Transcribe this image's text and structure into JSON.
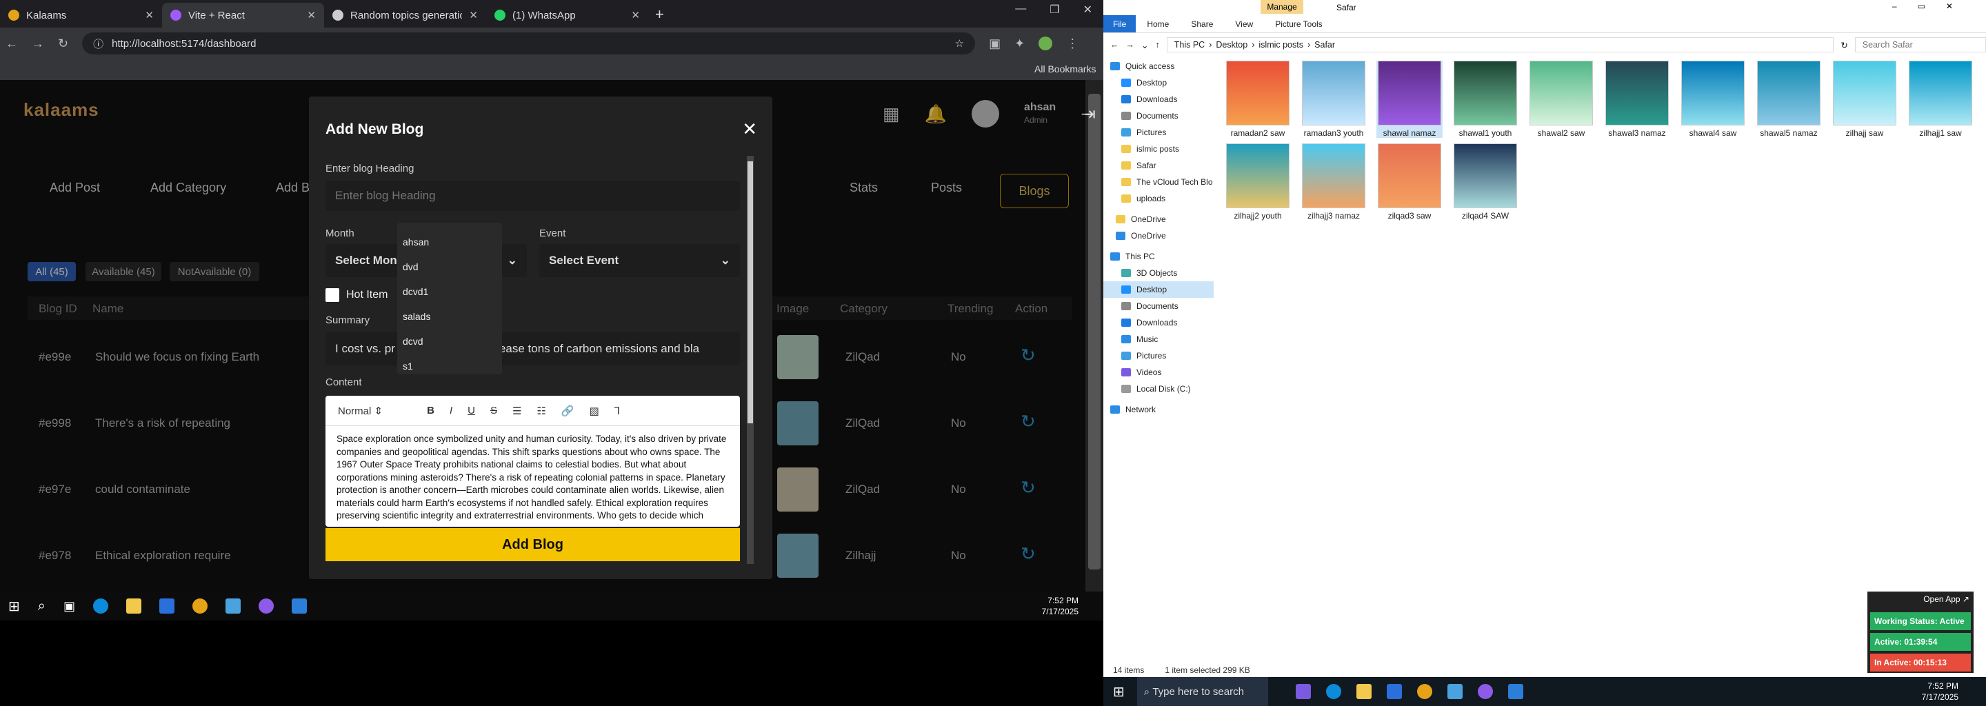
{
  "chrome": {
    "tabs": [
      {
        "title": "Kalaams",
        "color": "#e6a317"
      },
      {
        "title": "Vite + React",
        "color": "#a259ff"
      },
      {
        "title": "Random topics generation",
        "color": "#ccc"
      },
      {
        "title": "(1) WhatsApp",
        "color": "#25d366"
      }
    ],
    "url": "http://localhost:5174/dashboard",
    "all_bookmarks": "All Bookmarks"
  },
  "app": {
    "logo": "kalaams",
    "user": {
      "name": "ahsan",
      "role": "Admin"
    },
    "nav_left": [
      "Add Post",
      "Add Category",
      "Add Bl"
    ],
    "nav_right": [
      "Stats",
      "Posts",
      "Blogs"
    ],
    "filters": [
      "All (45)",
      "Available (45)",
      "NotAvailable (0)"
    ],
    "columns": [
      "Blog ID",
      "Name",
      "Image",
      "Category",
      "Trending",
      "Action"
    ],
    "rows": [
      {
        "id": "#e99e",
        "name": "Should we focus on fixing Earth",
        "category": "ZilQad",
        "trending": "No"
      },
      {
        "id": "#e998",
        "name": "There's a risk of repeating",
        "category": "ZilQad",
        "trending": "No"
      },
      {
        "id": "#e97e",
        "name": "could contaminate",
        "category": "ZilQad",
        "trending": "No"
      },
      {
        "id": "#e978",
        "name": "Ethical exploration require",
        "category": "Zilhajj",
        "trending": "No"
      }
    ]
  },
  "modal": {
    "title": "Add New Blog",
    "heading_label": "Enter blog Heading",
    "heading_placeholder": "Enter blog Heading",
    "month_label": "Month",
    "month_value": "Select Mon",
    "event_label": "Event",
    "event_value": "Select Event",
    "hot_item": "Hot Item",
    "summary_label": "Summary",
    "summary_left": "I cost vs. pr",
    "summary_right": "hes release tons of carbon emissions and bla",
    "content_label": "Content",
    "format": "Normal",
    "content": "Space exploration once symbolized unity and human curiosity. Today, it's also driven by private companies and geopolitical agendas. This shift sparks questions about who owns space. The 1967 Outer Space Treaty prohibits national claims to celestial bodies. But what about corporations mining asteroids? There's a risk of repeating colonial patterns in space. Planetary protection is another concern—Earth microbes could contaminate alien worlds. Likewise, alien materials could harm Earth's ecosystems if not handled safely. Ethical exploration requires preserving scientific integrity and extraterrestrial environments. Who gets to decide which missions are worth funding? Should we focus on fixing Earth first? Space tourism raises",
    "submit": "Add Blog",
    "autocomplete": [
      "ahsan",
      "dvd",
      "dcvd1",
      "salads",
      "dcvd",
      "s1"
    ]
  },
  "left_clock": {
    "time": "7:52 PM",
    "date": "7/17/2025"
  },
  "explorer": {
    "title": "Safar",
    "manage": "Manage",
    "ribbon": [
      "File",
      "Home",
      "Share",
      "View",
      "Picture Tools"
    ],
    "path": [
      "This PC",
      "Desktop",
      "islmic posts",
      "Safar"
    ],
    "search_placeholder": "Search Safar",
    "nav": [
      {
        "label": "Quick access",
        "color": "#2b8ce6"
      },
      {
        "label": "Desktop",
        "color": "#1e90ff"
      },
      {
        "label": "Downloads",
        "color": "#1e7be0"
      },
      {
        "label": "Documents",
        "color": "#888"
      },
      {
        "label": "Pictures",
        "color": "#3da0e0"
      },
      {
        "label": "islmic posts",
        "color": "#f2c94c"
      },
      {
        "label": "Safar",
        "color": "#f2c94c"
      },
      {
        "label": "The vCloud Tech Blo",
        "color": "#f2c94c"
      },
      {
        "label": "uploads",
        "color": "#f2c94c"
      },
      {
        "label": "OneDrive",
        "color": "#f2c94c"
      },
      {
        "label": "OneDrive",
        "color": "#2b8ce6"
      },
      {
        "label": "This PC",
        "color": "#2b8ce6"
      },
      {
        "label": "3D Objects",
        "color": "#4aa"
      },
      {
        "label": "Desktop",
        "color": "#1e90ff"
      },
      {
        "label": "Documents",
        "color": "#888"
      },
      {
        "label": "Downloads",
        "color": "#1e7be0"
      },
      {
        "label": "Music",
        "color": "#2b8ce6"
      },
      {
        "label": "Pictures",
        "color": "#3da0e0"
      },
      {
        "label": "Videos",
        "color": "#7a5ae0"
      },
      {
        "label": "Local Disk (C:)",
        "color": "#999"
      },
      {
        "label": "Network",
        "color": "#2b8ce6"
      }
    ],
    "files": [
      {
        "name": "ramadan2 saw",
        "c1": "#e94f37",
        "c2": "#f6a04d"
      },
      {
        "name": "ramadan3 youth",
        "c1": "#5fa8d3",
        "c2": "#cae9ff"
      },
      {
        "name": "shawal namaz",
        "c1": "#5b2a86",
        "c2": "#9b5de5"
      },
      {
        "name": "shawal1 youth",
        "c1": "#1b4332",
        "c2": "#74c69d"
      },
      {
        "name": "shawal2 saw",
        "c1": "#52b788",
        "c2": "#d8f3dc"
      },
      {
        "name": "shawal3 namaz",
        "c1": "#264653",
        "c2": "#2a9d8f"
      },
      {
        "name": "shawal4 saw",
        "c1": "#0077b6",
        "c2": "#90e0ef"
      },
      {
        "name": "shawal5 namaz",
        "c1": "#118ab2",
        "c2": "#8ecae6"
      },
      {
        "name": "zilhajj saw",
        "c1": "#48cae4",
        "c2": "#caf0f8"
      },
      {
        "name": "zilhajj1 saw",
        "c1": "#0096c7",
        "c2": "#ade8f4"
      },
      {
        "name": "zilhajj2 youth",
        "c1": "#219ebc",
        "c2": "#e9c46a"
      },
      {
        "name": "zilhajj3 namaz",
        "c1": "#4cc9f0",
        "c2": "#f4a261"
      },
      {
        "name": "zilqad3 saw",
        "c1": "#e76f51",
        "c2": "#f4a261"
      },
      {
        "name": "zilqad4 SAW",
        "c1": "#1d3557",
        "c2": "#a8dadc"
      }
    ],
    "status_items": "14 items",
    "status_selected": "1 item selected  299 KB"
  },
  "right_clock": {
    "time": "7:52 PM",
    "date": "7/17/2025"
  },
  "search_taskbar": "Type here to search",
  "widget": {
    "open": "Open App ↗",
    "working": "Working Status: Active",
    "active": "Active: 01:39:54",
    "inactive": "In Active: 00:15:13"
  }
}
